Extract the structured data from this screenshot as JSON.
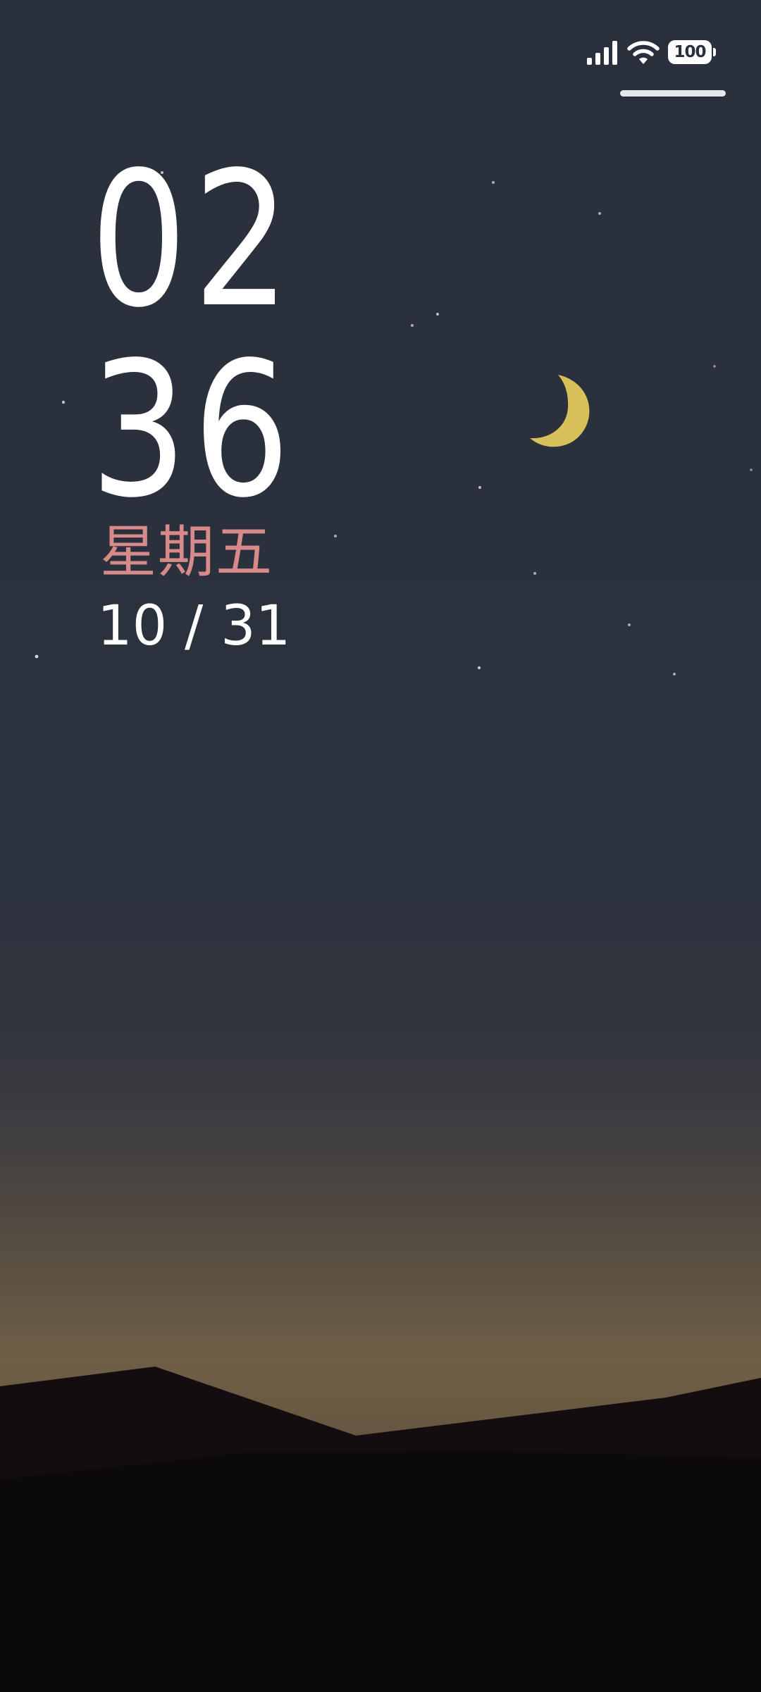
{
  "status_bar": {
    "signal_icon": "signal-bars-icon",
    "wifi_icon": "wifi-icon",
    "battery_level": "100"
  },
  "lock_screen": {
    "hours": "02",
    "minutes": "36",
    "weekday": "星期五",
    "date": "10 / 31"
  },
  "wallpaper": {
    "moon_icon": "crescent-moon-icon",
    "moon_color": "#d8c05a",
    "sky_color": "#2b323d",
    "horizon_glow_color": "#6f5f46",
    "hills_color": "#0c090a"
  },
  "colors": {
    "weekday_accent": "#d88a8a",
    "text_primary": "#ffffff"
  }
}
